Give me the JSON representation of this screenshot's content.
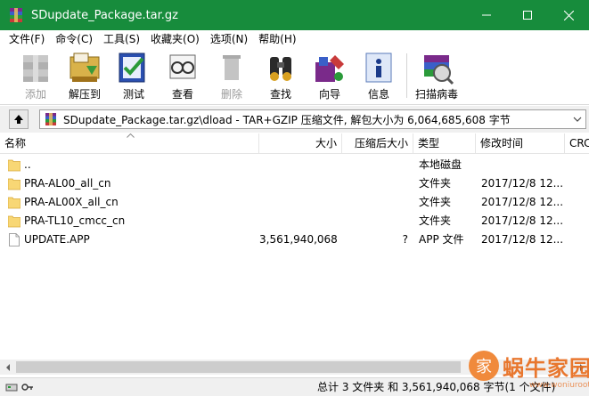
{
  "window": {
    "title": "SDupdate_Package.tar.gz",
    "titlebar_color": "#178c3c"
  },
  "menu": [
    "文件(F)",
    "命令(C)",
    "工具(S)",
    "收藏夹(O)",
    "选项(N)",
    "帮助(H)"
  ],
  "toolbar": {
    "buttons": [
      {
        "label": "添加",
        "icon": "add-archive-icon",
        "disabled": true
      },
      {
        "label": "解压到",
        "icon": "extract-icon",
        "disabled": false
      },
      {
        "label": "测试",
        "icon": "test-icon",
        "disabled": false
      },
      {
        "label": "查看",
        "icon": "view-icon",
        "disabled": false
      },
      {
        "label": "删除",
        "icon": "delete-icon",
        "disabled": true
      },
      {
        "label": "查找",
        "icon": "find-icon",
        "disabled": false
      },
      {
        "label": "向导",
        "icon": "wizard-icon",
        "disabled": false
      },
      {
        "label": "信息",
        "icon": "info-icon",
        "disabled": false
      },
      {
        "label": "扫描病毒",
        "icon": "virus-scan-icon",
        "disabled": false
      }
    ]
  },
  "address": {
    "path": "SDupdate_Package.tar.gz\\dload - TAR+GZIP 压缩文件, 解包大小为 6,064,685,608 字节"
  },
  "columns": [
    "名称",
    "大小",
    "压缩后大小",
    "类型",
    "修改时间",
    "CRC"
  ],
  "files": [
    {
      "name": "..",
      "size": "",
      "packed": "",
      "type": "本地磁盘",
      "modified": "",
      "kind": "folder"
    },
    {
      "name": "PRA-AL00_all_cn",
      "size": "",
      "packed": "",
      "type": "文件夹",
      "modified": "2017/12/8 12...",
      "kind": "folder"
    },
    {
      "name": "PRA-AL00X_all_cn",
      "size": "",
      "packed": "",
      "type": "文件夹",
      "modified": "2017/12/8 12...",
      "kind": "folder"
    },
    {
      "name": "PRA-TL10_cmcc_cn",
      "size": "",
      "packed": "",
      "type": "文件夹",
      "modified": "2017/12/8 12...",
      "kind": "folder"
    },
    {
      "name": "UPDATE.APP",
      "size": "3,561,940,068",
      "packed": "?",
      "type": "APP 文件",
      "modified": "2017/12/8 12...",
      "kind": "file"
    }
  ],
  "status": {
    "text": "总计 3 文件夹 和 3,561,940,068 字节(1 个文件)"
  },
  "watermark": {
    "badge": "家",
    "text": "蜗牛家园",
    "url": "www.woniuroot.cn"
  }
}
